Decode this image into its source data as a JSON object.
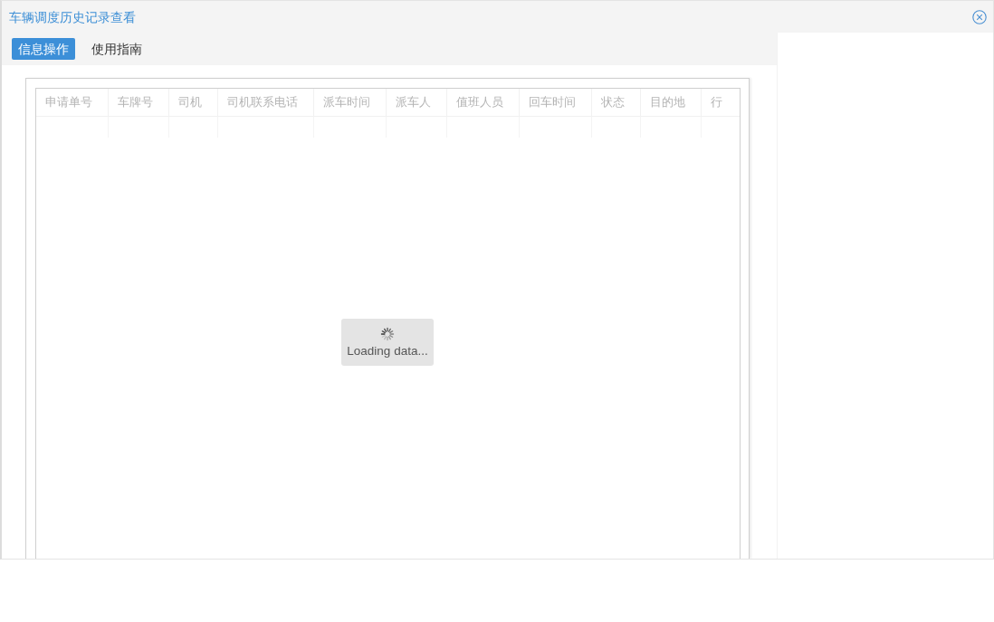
{
  "window": {
    "title": "车辆调度历史记录查看"
  },
  "tabs": [
    {
      "label": "信息操作",
      "selected": true
    },
    {
      "label": "使用指南",
      "selected": false
    }
  ],
  "table": {
    "columns": [
      "申请单号",
      "车牌号",
      "司机",
      "司机联系电话",
      "派车时间",
      "派车人",
      "值班人员",
      "回车时间",
      "状态",
      "目的地",
      "行"
    ]
  },
  "loading": {
    "text": "Loading data..."
  }
}
